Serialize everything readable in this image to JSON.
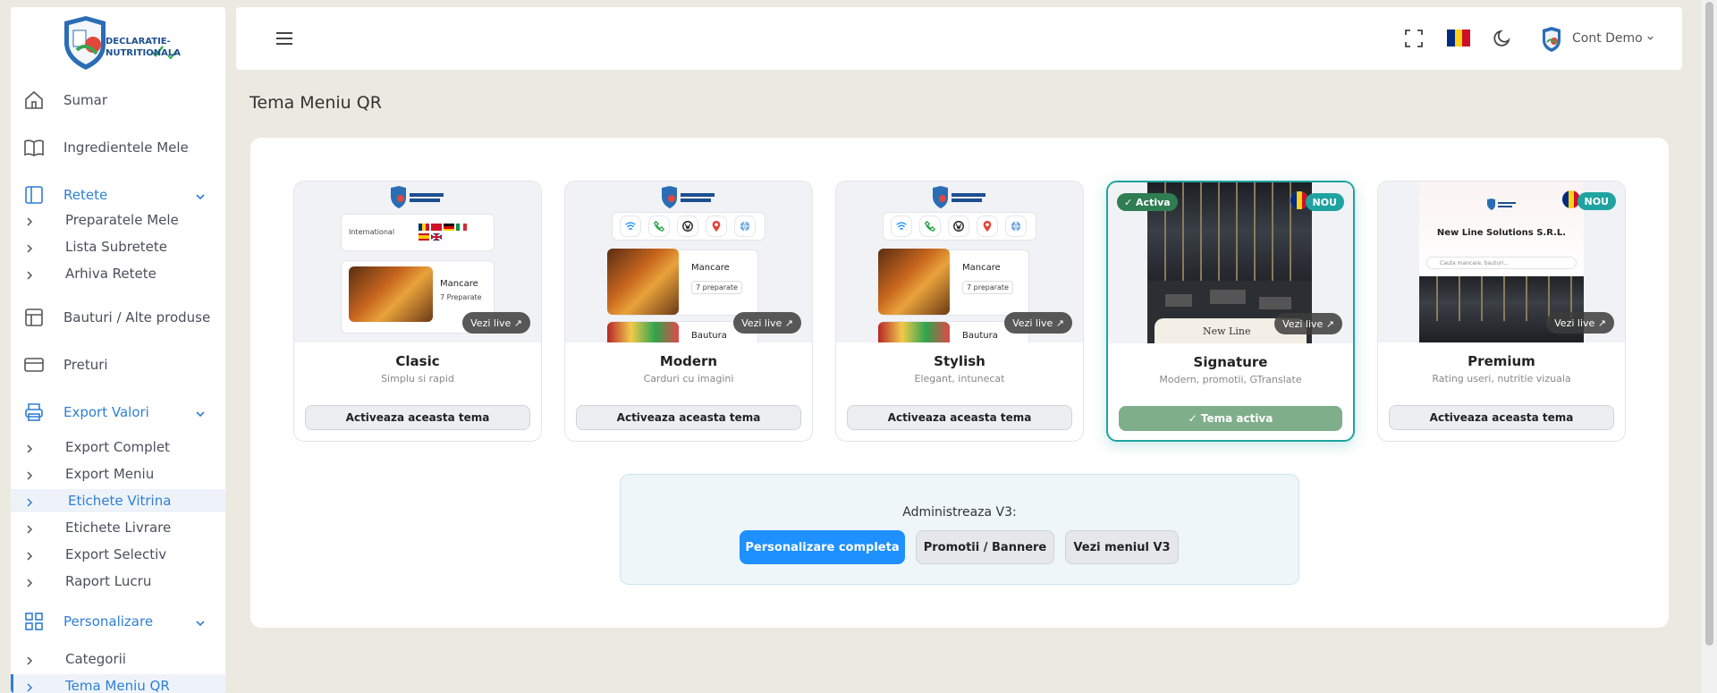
{
  "sidebar": {
    "logo_text": "DECLARATIE-NUTRITIONALA",
    "items": [
      {
        "label": "Sumar",
        "icon": "home-icon"
      },
      {
        "label": "Ingredientele Mele",
        "icon": "book-icon"
      },
      {
        "label": "Retete",
        "icon": "layout-icon"
      },
      {
        "label": "Preparatele Mele"
      },
      {
        "label": "Lista Subretete"
      },
      {
        "label": "Arhiva Retete"
      },
      {
        "label": "Bauturi / Alte produse",
        "icon": "table-icon"
      },
      {
        "label": "Preturi",
        "icon": "card-icon"
      },
      {
        "label": "Export Valori",
        "icon": "printer-icon"
      },
      {
        "label": "Export Complet"
      },
      {
        "label": "Export Meniu"
      },
      {
        "label": "Etichete Vitrina"
      },
      {
        "label": "Etichete Livrare"
      },
      {
        "label": "Export Selectiv"
      },
      {
        "label": "Raport Lucru"
      },
      {
        "label": "Personalizare",
        "icon": "grid-icon"
      },
      {
        "label": "Categorii"
      },
      {
        "label": "Tema Meniu QR"
      }
    ]
  },
  "topbar": {
    "account_name": "Cont Demo",
    "flag_colors": [
      "#002b7f",
      "#fcd116",
      "#ce1126"
    ]
  },
  "page": {
    "title": "Tema Meniu QR"
  },
  "themes": [
    {
      "name": "Clasic",
      "description": "Simplu si rapid",
      "button": "Activeaza aceasta tema",
      "live": "Vezi live ↗",
      "preview": {
        "lang_label": "International",
        "item_label": "Mancare",
        "item_count": "7 Preparate"
      }
    },
    {
      "name": "Modern",
      "description": "Carduri cu imagini",
      "button": "Activeaza aceasta tema",
      "live": "Vezi live ↗",
      "preview": {
        "item_label": "Mancare",
        "item_count": "7 preparate",
        "item2_label": "Bautura"
      }
    },
    {
      "name": "Stylish",
      "description": "Elegant, intunecat",
      "button": "Activeaza aceasta tema",
      "live": "Vezi live ↗",
      "preview": {
        "item_label": "Mancare",
        "item_count": "7 preparate",
        "item2_label": "Bautura"
      }
    },
    {
      "name": "Signature",
      "description": "Modern, promotii, GTranslate",
      "button": "✓ Tema activa",
      "live": "Vezi live ↗",
      "badge_active": "✓ Activa",
      "badge_new": "NOU",
      "preview": {
        "brand": "New Line"
      }
    },
    {
      "name": "Premium",
      "description": "Rating useri, nutritie vizuala",
      "button": "Activeaza aceasta tema",
      "live": "Vezi live ↗",
      "badge_new": "NOU",
      "preview": {
        "company": "New Line Solutions S.R.L.",
        "search": "Cauta mancare, bauturi..."
      }
    }
  ],
  "admin": {
    "title": "Administreaza V3:",
    "buttons": [
      "Personalizare completa",
      "Promotii / Bannere",
      "Vezi meniul V3"
    ]
  }
}
